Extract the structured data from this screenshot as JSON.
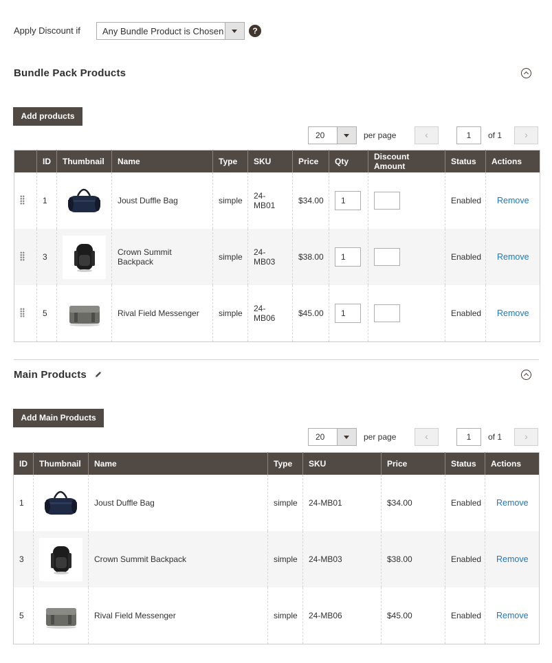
{
  "discount": {
    "label": "Apply Discount if",
    "selected": "Any Bundle Product is Chosen",
    "help": "?"
  },
  "bundle_section": {
    "title": "Bundle Pack Products",
    "add_button": "Add products",
    "pager": {
      "page_size": "20",
      "per_page_label": "per page",
      "current_page": "1",
      "of_label": "of 1",
      "prev": "‹",
      "next": "›"
    },
    "columns": [
      "",
      "ID",
      "Thumbnail",
      "Name",
      "Type",
      "SKU",
      "Price",
      "Qty",
      "Discount Amount",
      "Status",
      "Actions"
    ],
    "rows": [
      {
        "id": "1",
        "thumb": "duffle-bag",
        "name": "Joust Duffle Bag",
        "type": "simple",
        "sku": "24-MB01",
        "price": "$34.00",
        "qty": "1",
        "discount": "",
        "status": "Enabled",
        "action": "Remove"
      },
      {
        "id": "3",
        "thumb": "backpack",
        "name": "Crown Summit Backpack",
        "type": "simple",
        "sku": "24-MB03",
        "price": "$38.00",
        "qty": "1",
        "discount": "",
        "status": "Enabled",
        "action": "Remove"
      },
      {
        "id": "5",
        "thumb": "messenger-bag",
        "name": "Rival Field Messenger",
        "type": "simple",
        "sku": "24-MB06",
        "price": "$45.00",
        "qty": "1",
        "discount": "",
        "status": "Enabled",
        "action": "Remove"
      }
    ]
  },
  "main_section": {
    "title": "Main Products",
    "add_button": "Add Main Products",
    "pager": {
      "page_size": "20",
      "per_page_label": "per page",
      "current_page": "1",
      "of_label": "of 1",
      "prev": "‹",
      "next": "›"
    },
    "columns": [
      "ID",
      "Thumbnail",
      "Name",
      "Type",
      "SKU",
      "Price",
      "Status",
      "Actions"
    ],
    "rows": [
      {
        "id": "1",
        "thumb": "duffle-bag",
        "name": "Joust Duffle Bag",
        "type": "simple",
        "sku": "24-MB01",
        "price": "$34.00",
        "status": "Enabled",
        "action": "Remove"
      },
      {
        "id": "3",
        "thumb": "backpack",
        "name": "Crown Summit Backpack",
        "type": "simple",
        "sku": "24-MB03",
        "price": "$38.00",
        "status": "Enabled",
        "action": "Remove"
      },
      {
        "id": "5",
        "thumb": "messenger-bag",
        "name": "Rival Field Messenger",
        "type": "simple",
        "sku": "24-MB06",
        "price": "$45.00",
        "status": "Enabled",
        "action": "Remove"
      }
    ]
  },
  "colors": {
    "header_bg": "#514943",
    "link": "#1979c3",
    "row_alt": "#f5f5f5"
  }
}
